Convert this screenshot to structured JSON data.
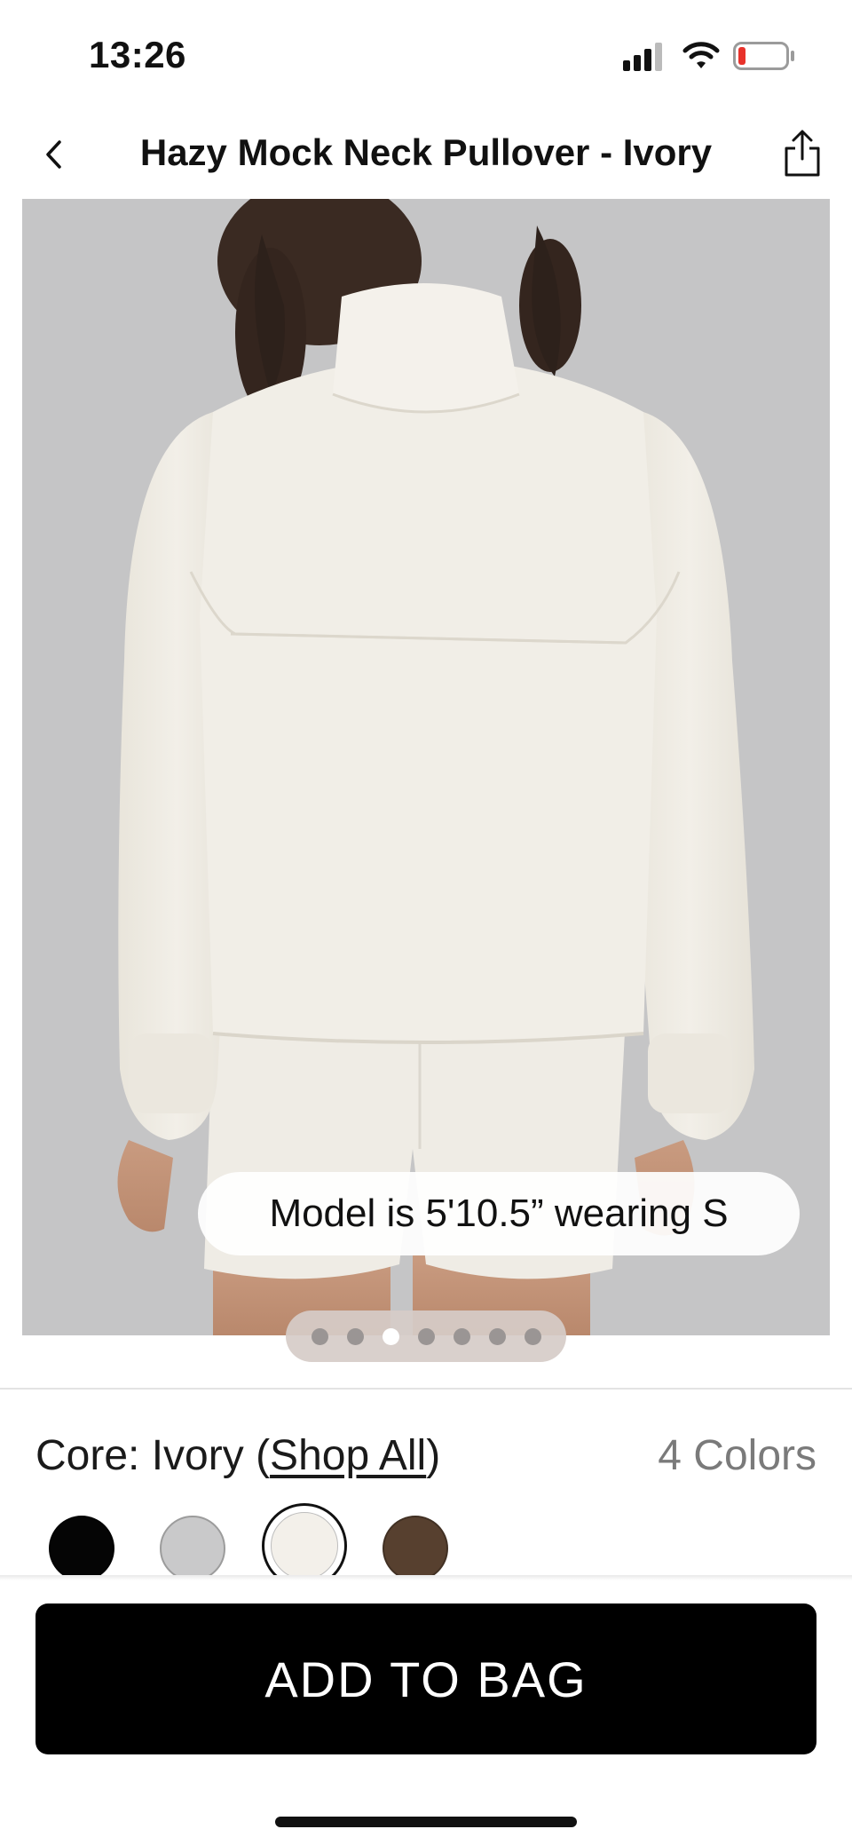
{
  "status_bar": {
    "time": "13:26",
    "icons": [
      "signal-icon",
      "wifi-icon",
      "battery-icon"
    ],
    "battery_level": 0.15
  },
  "header": {
    "title": "Hazy Mock Neck Pullover - Ivory",
    "back_icon": "chevron-left-icon",
    "share_icon": "share-icon"
  },
  "hero": {
    "model_note": "Model is 5'10.5” wearing S",
    "image_count": 7,
    "active_image": 3
  },
  "colors": {
    "label_prefix": "Core: Ivory (",
    "shop_all": "Shop All",
    "label_suffix": ")",
    "count_label": "4 Colors",
    "swatches": [
      {
        "name": "Black",
        "hex": "#050505"
      },
      {
        "name": "Grey",
        "hex": "#c9c9ca"
      },
      {
        "name": "Ivory",
        "hex": "#f3f0ea",
        "selected": true
      },
      {
        "name": "Brown",
        "hex": "#57402f"
      }
    ]
  },
  "actions": {
    "add_to_bag": "ADD TO BAG"
  }
}
